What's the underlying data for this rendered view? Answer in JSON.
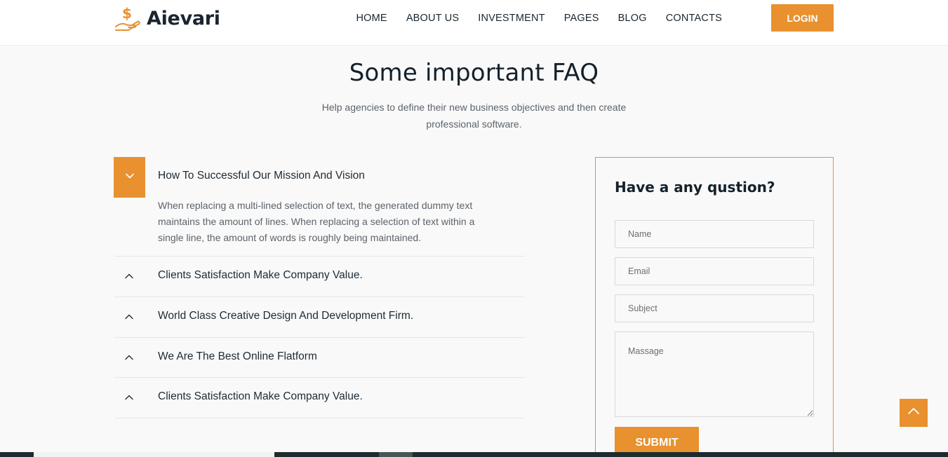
{
  "header": {
    "brand": "Aievari",
    "logo_icon": "dollar-hand-icon",
    "nav": [
      {
        "label": "HOME"
      },
      {
        "label": "ABOUT US"
      },
      {
        "label": "INVESTMENT"
      },
      {
        "label": "PAGES"
      },
      {
        "label": "BLOG"
      },
      {
        "label": "CONTACTS"
      }
    ],
    "login_label": "LOGIN"
  },
  "faq": {
    "title": "Some important FAQ",
    "subtitle_line1": "Help agencies to define their new business objectives and then create",
    "subtitle_line2": "professional software.",
    "open_item": {
      "question": "How To Successful Our Mission And Vision",
      "answer": "When replacing a multi-lined selection of text, the generated dummy text maintains the amount of lines. When replacing a selection of text within a single line, the amount of words is roughly being maintained.",
      "toggle_icon": "chevron-down-icon"
    },
    "items": [
      {
        "question": "Clients Satisfaction Make Company Value.",
        "icon": "chevron-up-icon"
      },
      {
        "question": "World Class Creative Design And Development Firm.",
        "icon": "chevron-up-icon"
      },
      {
        "question": "We Are The Best Online Flatform",
        "icon": "chevron-up-icon"
      },
      {
        "question": "Clients Satisfaction Make Company Value.",
        "icon": "chevron-up-icon"
      }
    ]
  },
  "form": {
    "title": "Have a any qustion?",
    "name_placeholder": "Name",
    "email_placeholder": "Email",
    "subject_placeholder": "Subject",
    "message_placeholder": "Massage",
    "submit_label": "SUBMIT"
  },
  "back_to_top_icon": "arrow-up-icon",
  "colors": {
    "accent": "#e8912e",
    "text_dark": "#14212b",
    "text_muted": "#5c636a",
    "background": "#f9f9f9"
  }
}
